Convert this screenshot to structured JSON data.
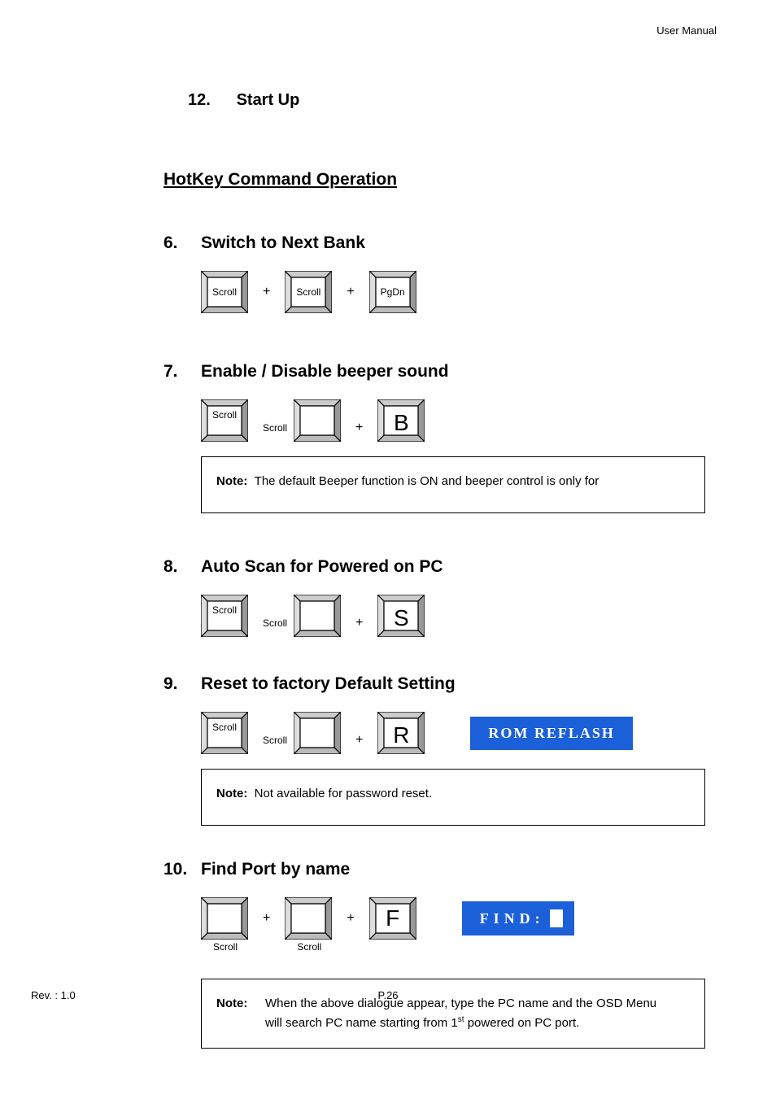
{
  "header": {
    "right": "User Manual"
  },
  "top": {
    "num": "12.",
    "title": "Start Up"
  },
  "main_title": "HotKey Command Operation",
  "sections": {
    "s6": {
      "num": "6.",
      "title": "Switch to Next Bank"
    },
    "s7": {
      "num": "7.",
      "title": "Enable / Disable beeper sound",
      "note_label": "Note:",
      "note": "The default Beeper function is ON and beeper control is only for"
    },
    "s8": {
      "num": "8.",
      "title": "Auto Scan for Powered on PC"
    },
    "s9": {
      "num": "9.",
      "title": "Reset to factory Default Setting",
      "note_label": "Note:",
      "note": "Not available for password reset.",
      "badge": "ROM  REFLASH"
    },
    "s10": {
      "num": "10.",
      "title": "Find Port by name",
      "badge": "FIND:",
      "note_label": "Note:",
      "note_line1": "When the above dialogue appear, type the PC name and the OSD Menu",
      "note_line2_a": "will search PC name starting from 1",
      "note_line2_sup": "st",
      "note_line2_b": " powered on PC port."
    }
  },
  "keys": {
    "scroll": "Scroll",
    "pgdn": "PgDn",
    "b": "B",
    "s": "S",
    "r": "R",
    "f": "F",
    "plus": "+"
  },
  "footer": {
    "rev": "Rev. : 1.0",
    "page": "P.26"
  }
}
